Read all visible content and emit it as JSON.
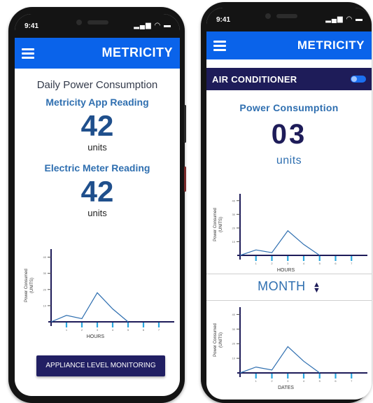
{
  "status_bar": {
    "time": "9:41",
    "signal_icon": "signal-icon",
    "wifi_icon": "wifi-icon",
    "battery_icon": "battery-icon"
  },
  "app": {
    "brand": "METRICITY",
    "accent": "#0a63ea",
    "dark": "#211f63"
  },
  "phone_left": {
    "heading": "Daily Power Consumption",
    "app_reading_label": "Metricity App Reading",
    "app_reading_value": "42",
    "app_reading_unit": "units",
    "meter_reading_label": "Electric Meter Reading",
    "meter_reading_value": "42",
    "meter_reading_unit": "units",
    "appliance_button": "APPLIANCE LEVEL MONITORING"
  },
  "phone_right": {
    "device_name": "AIR CONDITIONER",
    "power_label": "Power Consumption",
    "power_value": "03",
    "power_unit": "units",
    "period_selector": "MONTH"
  },
  "chart_data": [
    {
      "type": "line",
      "ylabel": "Power Consumed (UNITS)",
      "xlabel": "HOURS",
      "x": [
        0,
        1,
        2,
        3,
        4,
        5
      ],
      "y": [
        0,
        4,
        2,
        18,
        8,
        0
      ],
      "xticks": [
        "1",
        "2",
        "3",
        "4",
        "5",
        "6",
        "7"
      ],
      "yticks": [
        "10",
        "20",
        "30",
        "40"
      ],
      "ylim": [
        0,
        45
      ],
      "xlim": [
        0,
        8
      ]
    },
    {
      "type": "line",
      "ylabel": "Power Consumed (UNITS)",
      "xlabel": "HOURS",
      "x": [
        0,
        1,
        2,
        3,
        4,
        5
      ],
      "y": [
        0,
        4,
        2,
        18,
        8,
        0
      ],
      "xticks": [
        "1",
        "2",
        "3",
        "4",
        "5",
        "6",
        "7"
      ],
      "yticks": [
        "10",
        "20",
        "30",
        "40"
      ],
      "ylim": [
        0,
        45
      ],
      "xlim": [
        0,
        8
      ]
    },
    {
      "type": "line",
      "ylabel": "Power Consumed (UNITS)",
      "xlabel": "DATES",
      "x": [
        0,
        1,
        2,
        3,
        4,
        5
      ],
      "y": [
        0,
        4,
        2,
        18,
        8,
        0
      ],
      "xticks": [
        "1",
        "2",
        "3",
        "4",
        "5",
        "6",
        "7"
      ],
      "yticks": [
        "10",
        "20",
        "30",
        "40"
      ],
      "ylim": [
        0,
        45
      ],
      "xlim": [
        0,
        8
      ]
    }
  ]
}
